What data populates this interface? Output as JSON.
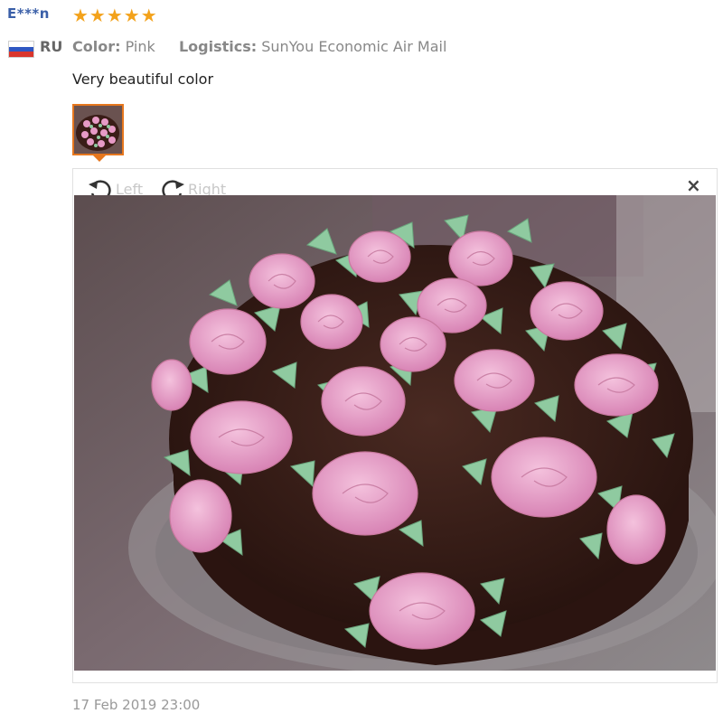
{
  "review": {
    "reviewer": "E***n",
    "rating": 5,
    "stars_text": "★★★★★",
    "country_code": "RU",
    "color_label": "Color:",
    "color_value": "Pink",
    "logistics_label": "Logistics:",
    "logistics_value": "SunYou Economic Air Mail",
    "comment": "Very beautiful color",
    "date": "17 Feb 2019 23:00"
  },
  "viewer": {
    "rotate_left_label": "Left",
    "rotate_right_label": "Right",
    "close_symbol": "×"
  },
  "colors": {
    "reviewer_name": "#3a5fa8",
    "star": "#f3a21b",
    "thumb_border": "#e6771e",
    "frosting_pink": "#e79bc6",
    "leaf_green": "#8fcaa0",
    "chocolate": "#3a1d17"
  },
  "icons": {
    "rotate_left": "rotate-left-icon",
    "rotate_right": "rotate-right-icon",
    "close": "close-icon"
  }
}
